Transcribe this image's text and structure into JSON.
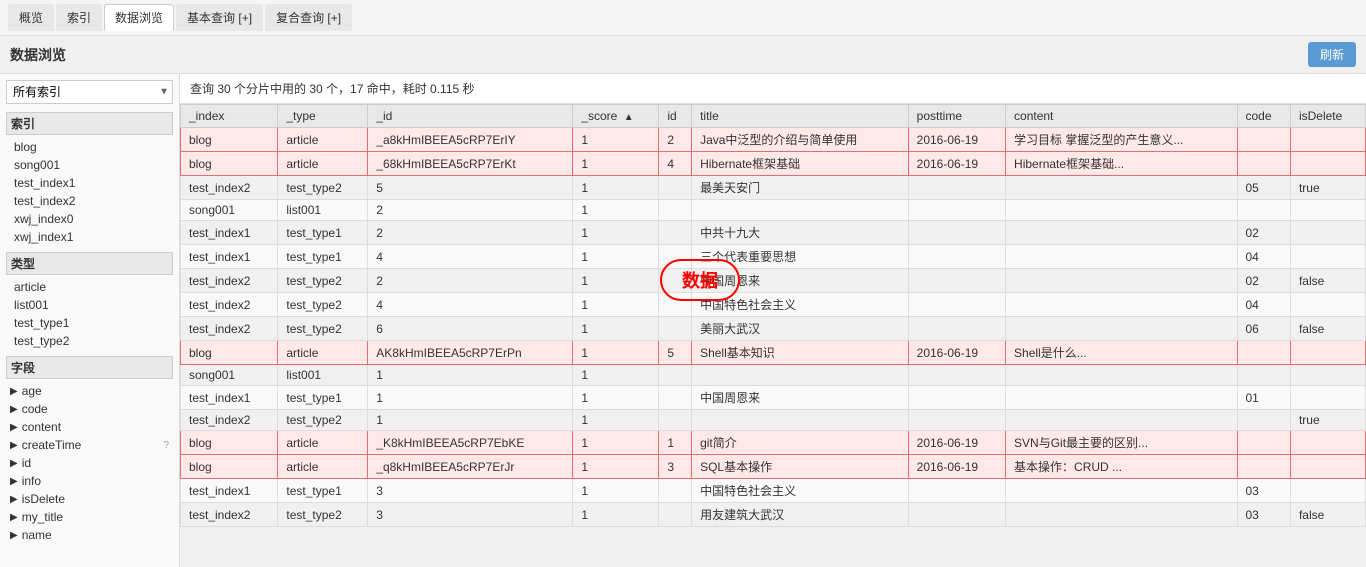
{
  "nav": {
    "tabs": [
      {
        "label": "概览",
        "active": false
      },
      {
        "label": "索引",
        "active": false
      },
      {
        "label": "数据浏览",
        "active": true
      },
      {
        "label": "基本查询 [+]",
        "active": false
      },
      {
        "label": "复合查询 [+]",
        "active": false
      }
    ]
  },
  "page": {
    "title": "数据浏览",
    "refresh_label": "刷新",
    "query_info": "查询 30 个分片中用的 30 个，17 命中，耗时 0.115 秒"
  },
  "sidebar": {
    "select_value": "所有索引",
    "select_placeholder": "所有索引",
    "index_section": {
      "title": "索引",
      "items": [
        "blog",
        "song001",
        "test_index1",
        "test_index2",
        "xwj_index0",
        "xwj_index1"
      ]
    },
    "type_section": {
      "title": "类型",
      "items": [
        "article",
        "list001",
        "test_type1",
        "test_type2"
      ]
    },
    "field_section": {
      "title": "字段",
      "items": [
        {
          "name": "age",
          "question": false
        },
        {
          "name": "code",
          "question": false
        },
        {
          "name": "content",
          "question": false
        },
        {
          "name": "createTime",
          "question": true
        },
        {
          "name": "id",
          "question": false
        },
        {
          "name": "info",
          "question": false
        },
        {
          "name": "isDelete",
          "question": false
        },
        {
          "name": "my_title",
          "question": false
        },
        {
          "name": "name",
          "question": false
        }
      ]
    }
  },
  "table": {
    "columns": [
      "_index",
      "_type",
      "_id",
      "_score",
      "id",
      "title",
      "posttime",
      "content",
      "code",
      "isDelete"
    ],
    "rows": [
      {
        "_index": "blog",
        "_type": "article",
        "_id": "_a8kHmIBEEA5cRP7ErIY",
        "_score": "1",
        "id": "2",
        "title": "Java中泛型的介绍与简单使用",
        "posttime": "2016-06-19",
        "content": "学习目标 掌握泛型的产生意义...",
        "code": "",
        "isDelete": "",
        "highlight": true
      },
      {
        "_index": "blog",
        "_type": "article",
        "_id": "_68kHmIBEEA5cRP7ErKt",
        "_score": "1",
        "id": "4",
        "title": "Hibernate框架基础",
        "posttime": "2016-06-19",
        "content": "Hibernate框架基础...",
        "code": "",
        "isDelete": "",
        "highlight": true
      },
      {
        "_index": "test_index2",
        "_type": "test_type2",
        "_id": "5",
        "_score": "1",
        "id": "",
        "title": "最美天安门",
        "posttime": "",
        "content": "",
        "code": "05",
        "isDelete": "true",
        "highlight": false
      },
      {
        "_index": "song001",
        "_type": "list001",
        "_id": "2",
        "_score": "1",
        "id": "",
        "title": "",
        "posttime": "",
        "content": "",
        "code": "",
        "isDelete": "",
        "highlight": false
      },
      {
        "_index": "test_index1",
        "_type": "test_type1",
        "_id": "2",
        "_score": "1",
        "id": "",
        "title": "中共十九大",
        "posttime": "",
        "content": "",
        "code": "02",
        "isDelete": "",
        "highlight": false
      },
      {
        "_index": "test_index1",
        "_type": "test_type1",
        "_id": "4",
        "_score": "1",
        "id": "",
        "title": "三个代表重要思想",
        "posttime": "",
        "content": "",
        "code": "04",
        "isDelete": "",
        "highlight": false
      },
      {
        "_index": "test_index2",
        "_type": "test_type2",
        "_id": "2",
        "_score": "1",
        "id": "",
        "title": "中国周恩来",
        "posttime": "",
        "content": "",
        "code": "02",
        "isDelete": "false",
        "highlight": false
      },
      {
        "_index": "test_index2",
        "_type": "test_type2",
        "_id": "4",
        "_score": "1",
        "id": "",
        "title": "中国特色社会主义",
        "posttime": "",
        "content": "",
        "code": "04",
        "isDelete": "",
        "highlight": false
      },
      {
        "_index": "test_index2",
        "_type": "test_type2",
        "_id": "6",
        "_score": "1",
        "id": "",
        "title": "美丽大武汉",
        "posttime": "",
        "content": "",
        "code": "06",
        "isDelete": "false",
        "highlight": false
      },
      {
        "_index": "blog",
        "_type": "article",
        "_id": "AK8kHmIBEEA5cRP7ErPn",
        "_score": "1",
        "id": "5",
        "title": "Shell基本知识",
        "posttime": "2016-06-19",
        "content": "Shell是什么...",
        "code": "",
        "isDelete": "",
        "highlight": true
      },
      {
        "_index": "song001",
        "_type": "list001",
        "_id": "1",
        "_score": "1",
        "id": "",
        "title": "",
        "posttime": "",
        "content": "",
        "code": "",
        "isDelete": "",
        "highlight": false
      },
      {
        "_index": "test_index1",
        "_type": "test_type1",
        "_id": "1",
        "_score": "1",
        "id": "",
        "title": "中国周恩来",
        "posttime": "",
        "content": "",
        "code": "01",
        "isDelete": "",
        "highlight": false
      },
      {
        "_index": "test_index2",
        "_type": "test_type2",
        "_id": "1",
        "_score": "1",
        "id": "",
        "title": "",
        "posttime": "",
        "content": "",
        "code": "",
        "isDelete": "true",
        "highlight": false
      },
      {
        "_index": "blog",
        "_type": "article",
        "_id": "_K8kHmIBEEA5cRP7EbKE",
        "_score": "1",
        "id": "1",
        "title": "git简介",
        "posttime": "2016-06-19",
        "content": "SVN与Git最主要的区别...",
        "code": "",
        "isDelete": "",
        "highlight": true
      },
      {
        "_index": "blog",
        "_type": "article",
        "_id": "_q8kHmIBEEA5cRP7ErJr",
        "_score": "1",
        "id": "3",
        "title": "SQL基本操作",
        "posttime": "2016-06-19",
        "content": "基本操作：CRUD ...",
        "code": "",
        "isDelete": "",
        "highlight": true
      },
      {
        "_index": "test_index1",
        "_type": "test_type1",
        "_id": "3",
        "_score": "1",
        "id": "",
        "title": "中国特色社会主义",
        "posttime": "",
        "content": "",
        "code": "03",
        "isDelete": "",
        "highlight": false
      },
      {
        "_index": "test_index2",
        "_type": "test_type2",
        "_id": "3",
        "_score": "1",
        "id": "",
        "title": "用友建筑大武汉",
        "posttime": "",
        "content": "",
        "code": "03",
        "isDelete": "false",
        "highlight": false
      }
    ]
  },
  "annotation": {
    "label": "数据"
  }
}
